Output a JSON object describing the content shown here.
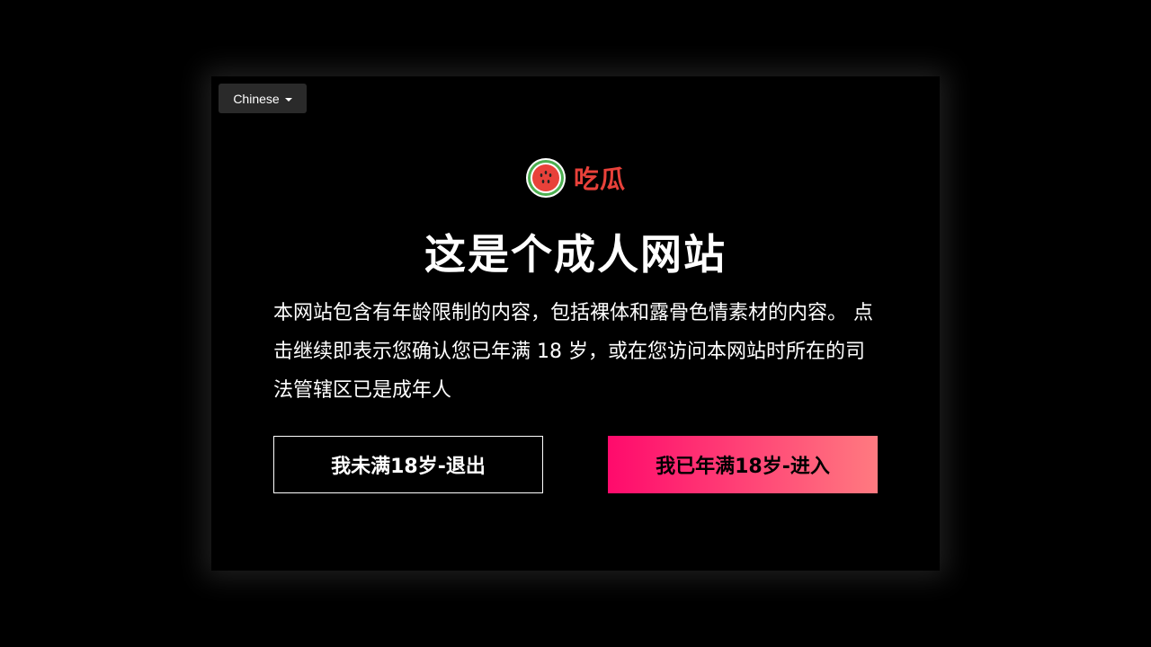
{
  "language_select": {
    "selected": "Chinese"
  },
  "logo": {
    "text": "吃瓜",
    "icon": "watermelon-icon",
    "brand_color": "#e8413a"
  },
  "title": "这是个成人网站",
  "description": "本网站包含有年龄限制的内容，包括裸体和露骨色情素材的内容。 点击继续即表示您确认您已年满 18 岁，或在您访问本网站时所在的司法管辖区已是成年人",
  "buttons": {
    "exit_label": "我未满18岁-退出",
    "enter_label": "我已年满18岁-进入"
  },
  "colors": {
    "background": "#000000",
    "enter_gradient_start": "#ff0a6c",
    "enter_gradient_end": "#ff7a80",
    "dropdown_bg": "#2a2a2a"
  }
}
